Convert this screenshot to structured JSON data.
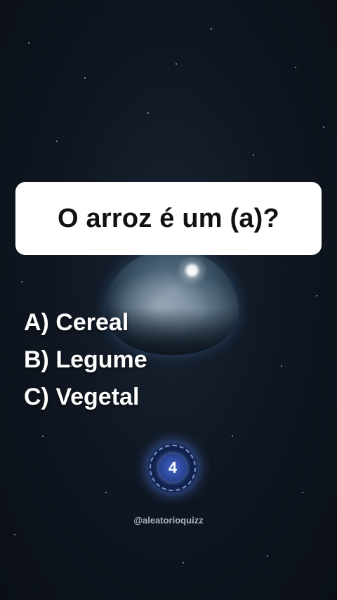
{
  "quiz": {
    "question": "O arroz é um (a)?",
    "options": [
      {
        "label": "A) Cereal"
      },
      {
        "label": "B) Legume"
      },
      {
        "label": "C) Vegetal"
      }
    ],
    "timer": "4"
  },
  "footer": {
    "handle": "@aleatorioquizz"
  },
  "colors": {
    "card": "#ffffff",
    "timer_accent": "#4163c6",
    "background": "#101722"
  }
}
